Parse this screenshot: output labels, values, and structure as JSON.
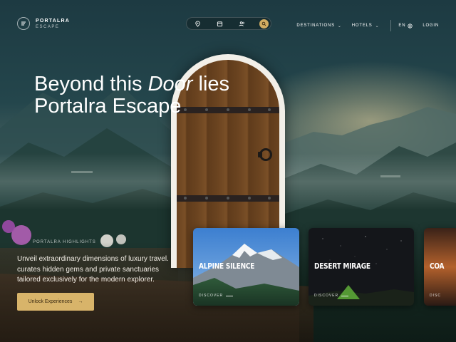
{
  "nav": {
    "brand_name": "PORTALRA",
    "brand_sub": "ESCAPE",
    "search_icons": [
      "location-pin-icon",
      "calendar-icon",
      "guests-icon",
      "search-icon"
    ],
    "menu": [
      {
        "label": "DESTINATIONS",
        "chevron": "⌄"
      },
      {
        "label": "HOTELS",
        "chevron": "⌄"
      }
    ],
    "language": "EN",
    "login": "LOGIN"
  },
  "hero": {
    "title_part1": "Beyond this ",
    "title_italic": "Door",
    "title_part2": " lies",
    "title_line2": "Portalra Escape"
  },
  "highlights": {
    "label": "PORTALRA HIGHLIGHTS",
    "text_line1": "Unveil extraordinary dimensions of luxury travel.",
    "text_line2": "curates hidden gems and private sanctuaries",
    "text_line3": "tailored exclusively for the modern explorer.",
    "cta_label": "Unlock Experiences",
    "cta_arrow": "→"
  },
  "cards": [
    {
      "title": "ALPINE SILENCE",
      "link": "DISCOVER"
    },
    {
      "title": "DESERT MIRAGE",
      "link": "DISCOVER"
    },
    {
      "title": "COA",
      "link": "DISC"
    }
  ],
  "colors": {
    "accent_gold": "#d8b46a",
    "sky_teal": "#24464c",
    "door_wood": "#6b4420"
  }
}
